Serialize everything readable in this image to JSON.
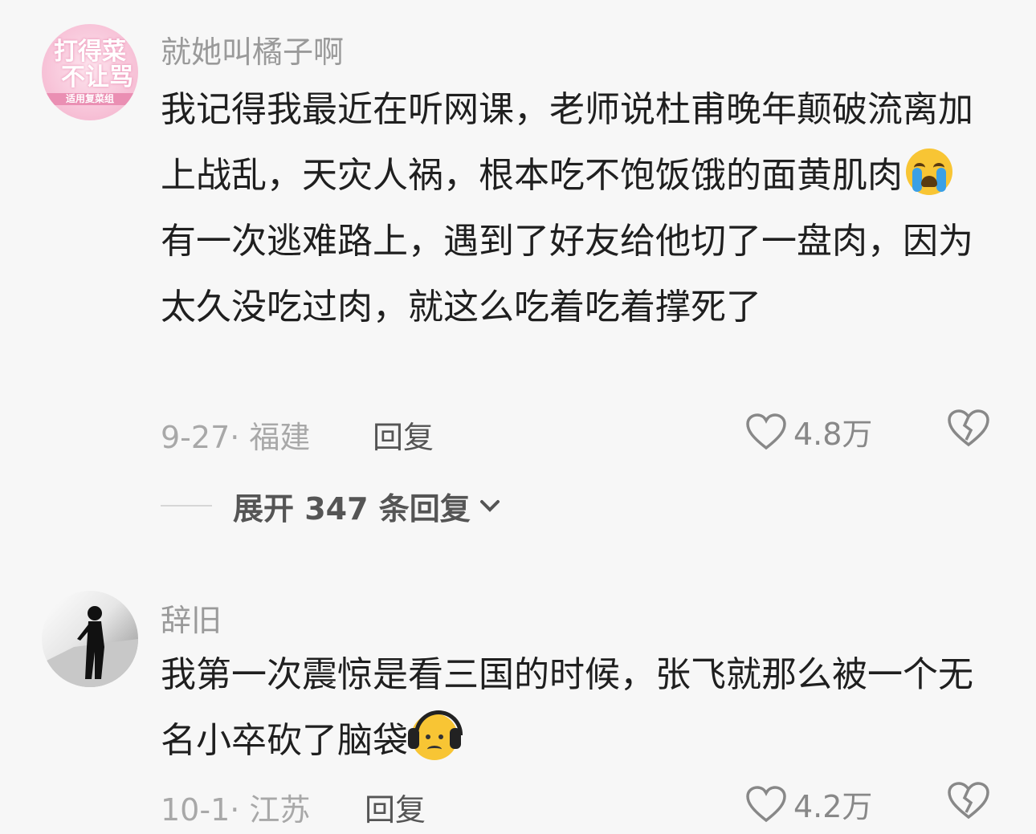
{
  "comments": [
    {
      "avatar_text": [
        "打得菜",
        "不让骂",
        "适用复菜组"
      ],
      "username": "就她叫橘子啊",
      "text_before_emoji": "我记得我最近在听网课，老师说杜甫晚年颠破流离加上战乱，天灾人祸，根本吃不饱饭饿的面黄肌肉",
      "emoji": "crying-face-icon",
      "text_after_emoji": "有一次逃难路上，遇到了好友给他切了一盘肉，因为太久没吃过肉，就这么吃着吃着撑死了",
      "date_location": "9-27· 福建",
      "reply_label": "回复",
      "like_count": "4.8万"
    },
    {
      "username": "辞旧",
      "text_before_emoji": "我第一次震惊是看三国的时候，张飞就那么被一个无名小卒砍了脑袋",
      "emoji": "headphones-face-icon",
      "text_after_emoji": "",
      "date_location": "10-1· 江苏",
      "reply_label": "回复",
      "like_count": "4.2万"
    }
  ],
  "expand_replies": {
    "label": "展开 347 条回复"
  },
  "colors": {
    "background": "#f7f7f7",
    "text": "#1f1f1f",
    "muted": "#9a9a9a",
    "avatar_pink": "#f6bcd3"
  }
}
